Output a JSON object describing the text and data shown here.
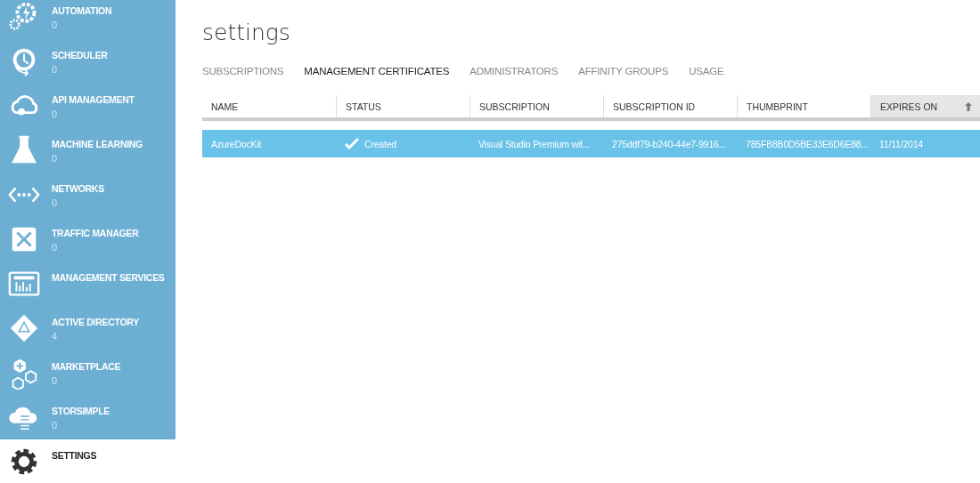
{
  "sidebar": {
    "items": [
      {
        "label": "AUTOMATION",
        "count": "0",
        "selected": false
      },
      {
        "label": "SCHEDULER",
        "count": "0",
        "selected": false
      },
      {
        "label": "API MANAGEMENT",
        "count": "0",
        "selected": false
      },
      {
        "label": "MACHINE LEARNING",
        "count": "0",
        "selected": false
      },
      {
        "label": "NETWORKS",
        "count": "0",
        "selected": false
      },
      {
        "label": "TRAFFIC MANAGER",
        "count": "0",
        "selected": false
      },
      {
        "label": "MANAGEMENT SERVICES",
        "selected": false
      },
      {
        "label": "ACTIVE DIRECTORY",
        "count": "4",
        "selected": false
      },
      {
        "label": "MARKETPLACE",
        "count": "0",
        "selected": false
      },
      {
        "label": "STORSIMPLE",
        "count": "0",
        "selected": false
      },
      {
        "label": "SETTINGS",
        "selected": true
      }
    ]
  },
  "page": {
    "title": "settings"
  },
  "tabs": [
    {
      "label": "SUBSCRIPTIONS",
      "selected": false
    },
    {
      "label": "MANAGEMENT CERTIFICATES",
      "selected": true
    },
    {
      "label": "ADMINISTRATORS",
      "selected": false
    },
    {
      "label": "AFFINITY GROUPS",
      "selected": false
    },
    {
      "label": "USAGE",
      "selected": false
    }
  ],
  "table": {
    "columns": [
      {
        "label": "NAME",
        "sorted": false
      },
      {
        "label": "STATUS",
        "sorted": false
      },
      {
        "label": "SUBSCRIPTION",
        "sorted": false
      },
      {
        "label": "SUBSCRIPTION ID",
        "sorted": false
      },
      {
        "label": "THUMBPRINT",
        "sorted": false
      },
      {
        "label": "EXPIRES ON",
        "sorted": true
      }
    ],
    "rows": [
      {
        "selected": true,
        "cells": [
          "AzureDocKit",
          "Created",
          "Visual Studio Premium wit...",
          "275ddf79-b240-44e7-9916...",
          "785FB8B0D5BE33E6D6E88...",
          "11/11/2014"
        ]
      }
    ]
  }
}
